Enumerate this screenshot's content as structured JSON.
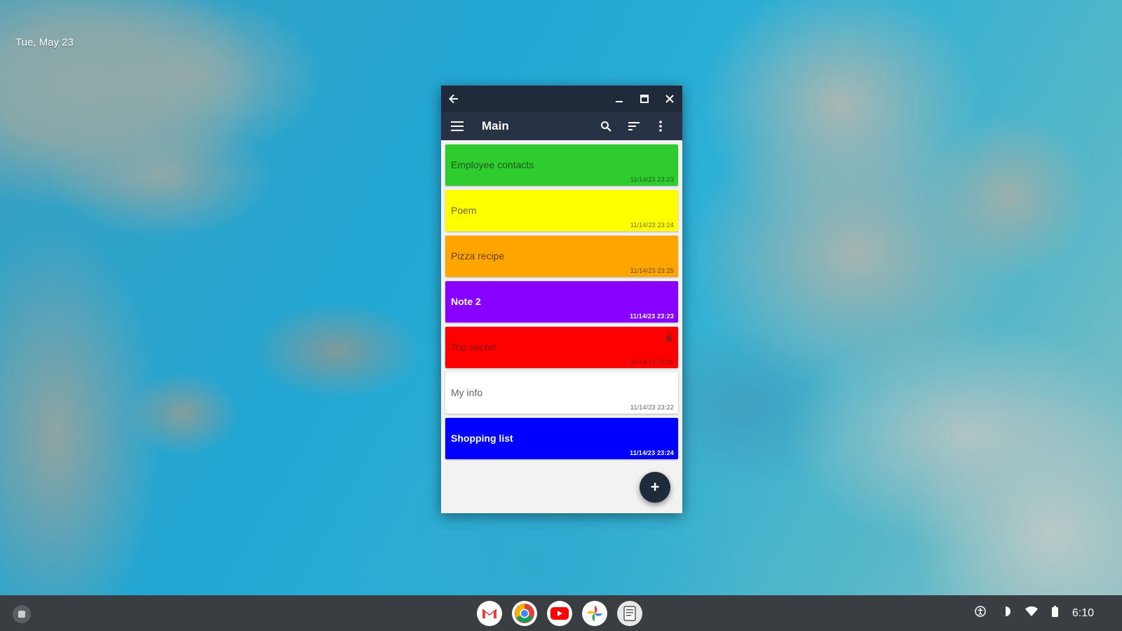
{
  "desktop": {
    "date": "Tue, May 23"
  },
  "window": {
    "title": "Main",
    "notes": [
      {
        "title": "Employee contacts",
        "date": "11/14/23 23:23",
        "bg": "#2ecc2e",
        "fg": "#1a5a1a"
      },
      {
        "title": "Poem",
        "date": "11/14/23 23:24",
        "bg": "#ffff00",
        "fg": "#6b6b00"
      },
      {
        "title": "Pizza recipe",
        "date": "11/14/23 23:25",
        "bg": "#ffa500",
        "fg": "#6b4300"
      },
      {
        "title": "Note 2",
        "date": "11/14/23 23:23",
        "bg": "#8800ff",
        "fg": "#ffffff"
      },
      {
        "title": "Top secret",
        "date": "11/14/23 23:26",
        "bg": "#ff0000",
        "fg": "#8a0000",
        "locked": true
      },
      {
        "title": "My info",
        "date": "11/14/23 23:22",
        "bg": "#ffffff",
        "fg": "#666666"
      },
      {
        "title": "Shopping list",
        "date": "11/14/23 23:24",
        "bg": "#0000ff",
        "fg": "#ffffff"
      }
    ],
    "fab_label": "+"
  },
  "shelf": {
    "apps": [
      "gmail-icon",
      "chrome-icon",
      "youtube-icon",
      "photos-icon",
      "notes-app-icon"
    ],
    "time": "6:10"
  }
}
